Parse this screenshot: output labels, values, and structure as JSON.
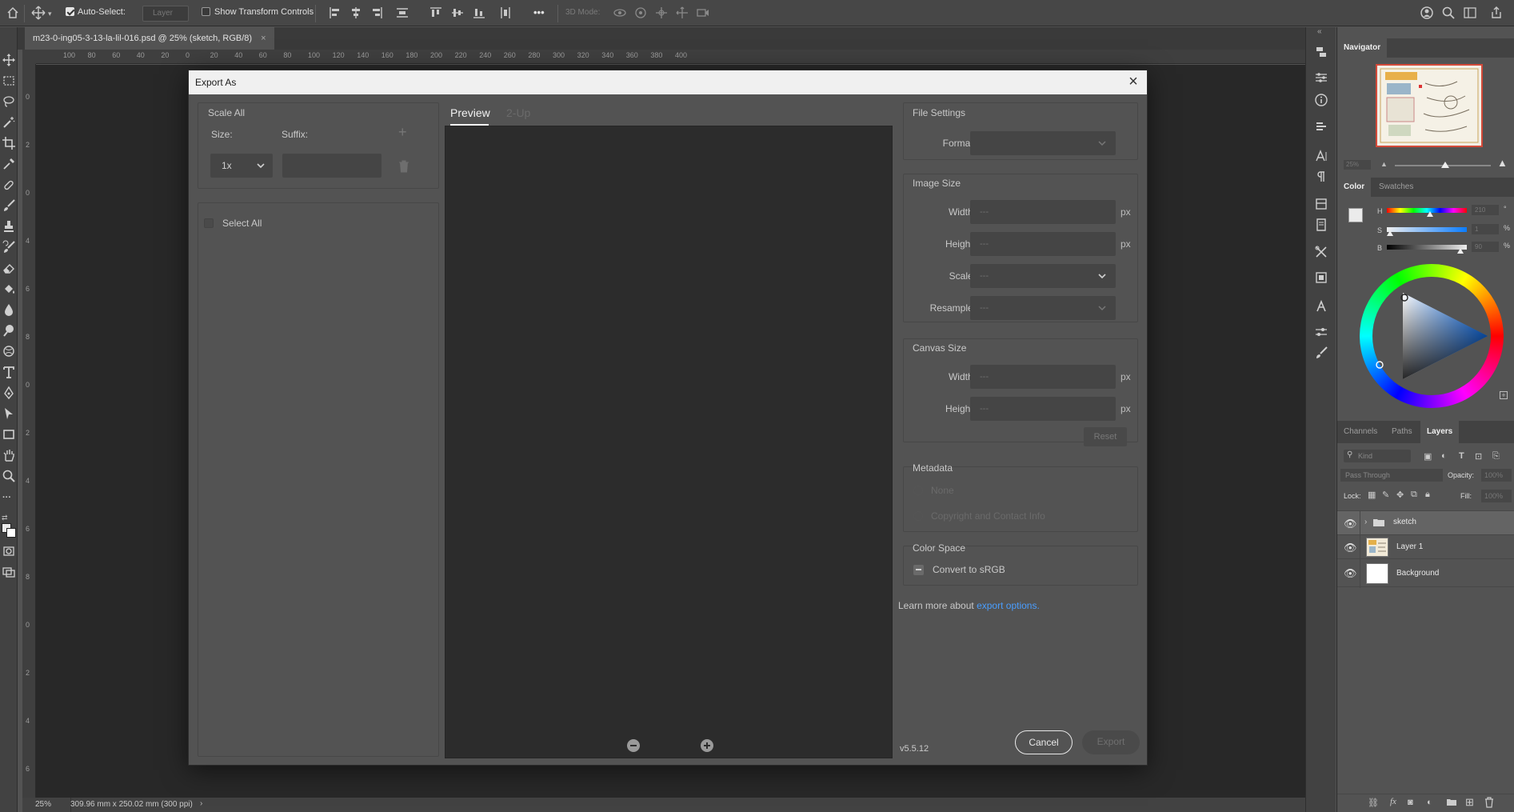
{
  "options_bar": {
    "auto_select_label": "Auto-Select:",
    "auto_select_value": "Layer",
    "show_transform_label": "Show Transform Controls",
    "three_d_mode_label": "3D Mode:",
    "more_label": "•••"
  },
  "document": {
    "tab_title": "m23-0-ing05-3-13-la-lil-016.psd @ 25% (sketch, RGB/8)",
    "tab_close": "×",
    "ruler_top_labels": [
      "100",
      "80",
      "60",
      "40",
      "20",
      "0",
      "20",
      "40",
      "60",
      "80",
      "100",
      "120",
      "140",
      "160",
      "180",
      "200",
      "220",
      "240",
      "260",
      "280",
      "300",
      "320",
      "340",
      "360",
      "380",
      "400"
    ],
    "ruler_left_labels": [
      "0",
      "2",
      "0",
      "4",
      "6",
      "8",
      "0",
      "2",
      "4",
      "6",
      "8",
      "0",
      "2",
      "4",
      "6"
    ],
    "zoom": "25%",
    "doc_size": "309.96 mm x 250.02 mm (300 ppi)"
  },
  "dialog": {
    "title": "Export As",
    "close": "×",
    "scale_all": {
      "heading": "Scale All",
      "size_label": "Size:",
      "suffix_label": "Suffix:",
      "size_value": "1x",
      "suffix_value": ""
    },
    "select_all_label": "Select All",
    "preview_tabs": [
      "Preview",
      "2-Up"
    ],
    "file_settings": {
      "heading": "File Settings",
      "format_label": "Format:",
      "format_value": ""
    },
    "image_size": {
      "heading": "Image Size",
      "width_label": "Width:",
      "height_label": "Height:",
      "scale_label": "Scale:",
      "resample_label": "Resample:",
      "width_value": "---",
      "height_value": "---",
      "scale_value": "---",
      "resample_value": "---",
      "unit": "px"
    },
    "canvas_size": {
      "heading": "Canvas Size",
      "width_label": "Width:",
      "height_label": "Height:",
      "width_value": "---",
      "height_value": "---",
      "unit": "px",
      "reset_label": "Reset"
    },
    "metadata": {
      "heading": "Metadata",
      "options": [
        "None",
        "Copyright and Contact Info"
      ]
    },
    "color_space": {
      "heading": "Color Space",
      "convert_label": "Convert to sRGB"
    },
    "learn_more_prefix": "Learn more about",
    "learn_more_link": "export options.",
    "version": "v5.5.12",
    "cancel_label": "Cancel",
    "export_label": "Export"
  },
  "navigator": {
    "tab": "Navigator",
    "zoom_value": "25%"
  },
  "color_panel": {
    "tabs": [
      "Color",
      "Swatches"
    ],
    "h_label": "H",
    "s_label": "S",
    "b_label": "B",
    "h_value": "210",
    "s_value": "1",
    "b_value": "90",
    "deg": "°",
    "pct": "%"
  },
  "layers_panel": {
    "tabs": [
      "Channels",
      "Paths",
      "Layers"
    ],
    "kind_placeholder": "Kind",
    "blend_mode": "Pass Through",
    "opacity_label": "Opacity:",
    "opacity_value": "100%",
    "lock_label": "Lock:",
    "fill_label": "Fill:",
    "fill_value": "100%",
    "layers": [
      {
        "name": "sketch"
      },
      {
        "name": "Layer 1"
      },
      {
        "name": "Background"
      }
    ]
  },
  "colors": {
    "accent_blue": "#4a9eff",
    "panel_bg": "#535353",
    "dialog_title_bg": "#f0f0f0",
    "preview_bg": "#2c2c2c"
  },
  "icons": [
    "home-icon",
    "move-tool-icon",
    "marquee-icon",
    "lasso-icon",
    "magic-wand-icon",
    "crop-icon",
    "eyedropper-icon",
    "healing-brush-icon",
    "brush-icon",
    "clone-stamp-icon",
    "history-brush-icon",
    "eraser-icon",
    "paint-bucket-icon",
    "blur-icon",
    "dodge-icon",
    "pen-icon",
    "type-icon",
    "path-select-icon",
    "rectangle-icon",
    "hand-icon",
    "zoom-icon",
    "search-icon",
    "trash-icon",
    "plus-icon",
    "zoom-in-icon",
    "zoom-out-icon",
    "eye-icon",
    "folder-icon"
  ]
}
